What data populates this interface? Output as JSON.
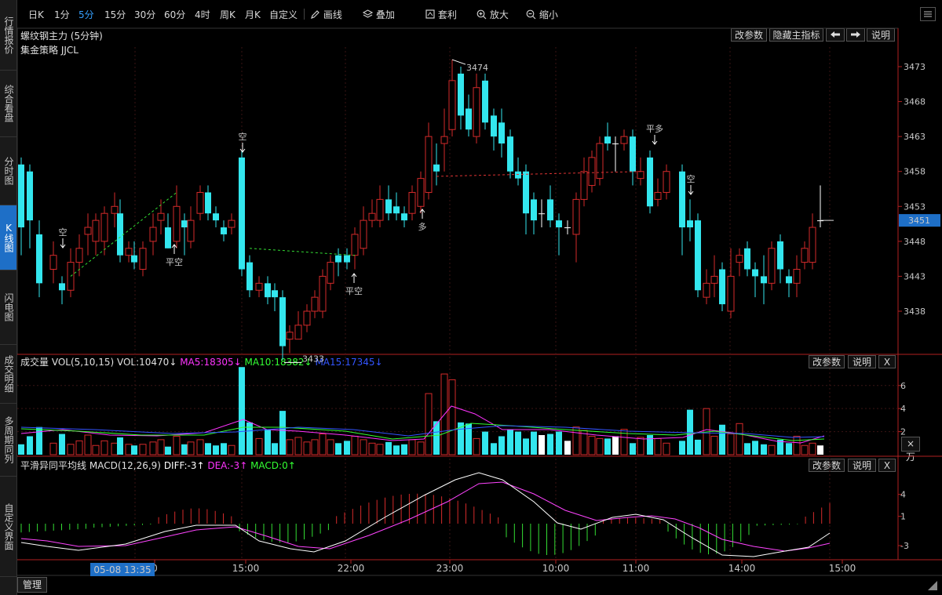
{
  "left_tabs": [
    "行情报价",
    "综合看盘",
    "分时图",
    "K线图",
    "闪电图",
    "成交明细",
    "多周期同列",
    "自定义界面"
  ],
  "toolbar": {
    "periods": [
      "日K",
      "1分",
      "5分",
      "15分",
      "30分",
      "60分",
      "4时",
      "周K",
      "月K",
      "自定义"
    ],
    "active_period": "5分",
    "tools": [
      {
        "icon": "pen-icon",
        "label": "画线"
      },
      {
        "icon": "layers-icon",
        "label": "叠加"
      },
      {
        "icon": "arbitrage-icon",
        "label": "套利"
      },
      {
        "icon": "zoom-in-icon",
        "label": "放大"
      },
      {
        "icon": "zoom-out-icon",
        "label": "缩小"
      }
    ]
  },
  "main_panel": {
    "title": "螺纹钢主力 (5分钟)",
    "strategy": "集金策略 JJCL",
    "buttons": [
      "改参数",
      "隐藏主指标",
      "说明"
    ],
    "y_ticks": [
      "3473",
      "3468",
      "3463",
      "3458",
      "3453",
      "3448",
      "3443",
      "3438"
    ],
    "current_price": "3451",
    "high_label": "3474",
    "low_label": "3433",
    "signals": [
      {
        "text": "空",
        "color": "#22dd22"
      },
      {
        "text": "平空",
        "color": "#ff3333"
      },
      {
        "text": "空",
        "color": "#22dd22"
      },
      {
        "text": "平空",
        "color": "#ff3333"
      },
      {
        "text": "多",
        "color": "#ff3333"
      },
      {
        "text": "平多",
        "color": "#22dd22"
      },
      {
        "text": "空",
        "color": "#22dd22"
      }
    ]
  },
  "volume_panel": {
    "label": "成交量",
    "indicator": "VOL(5,10,15)",
    "vol": "VOL:10470↓",
    "ma5": "MA5:18305↓",
    "ma10": "MA10:18382↓",
    "ma15": "MA15:17345↓",
    "buttons": [
      "改参数",
      "说明",
      "X"
    ],
    "y_ticks": [
      "6",
      "4",
      "2"
    ],
    "unit_button": "×万"
  },
  "macd_panel": {
    "label": "平滑异同平均线",
    "indicator": "MACD(12,26,9)",
    "diff": "DIFF:-3↑",
    "dea": "DEA:-3↑",
    "macd": "MACD:0↑",
    "buttons": [
      "改参数",
      "说明",
      "X"
    ],
    "y_ticks": [
      "4",
      "1",
      "-3"
    ]
  },
  "time_axis": {
    "cursor_label": "05-08 13:35",
    "ticks": [
      "0",
      "15:00",
      "22:00",
      "23:00",
      "10:00",
      "11:00",
      "14:00",
      "15:00"
    ]
  },
  "bottom_tab": "管理",
  "colors": {
    "up": "#d42a2a",
    "down": "#33e6ee",
    "highlight": "#1e6fc7",
    "ma5": "#ff33ff",
    "ma10": "#33ff33",
    "ma15": "#3355ff"
  }
}
